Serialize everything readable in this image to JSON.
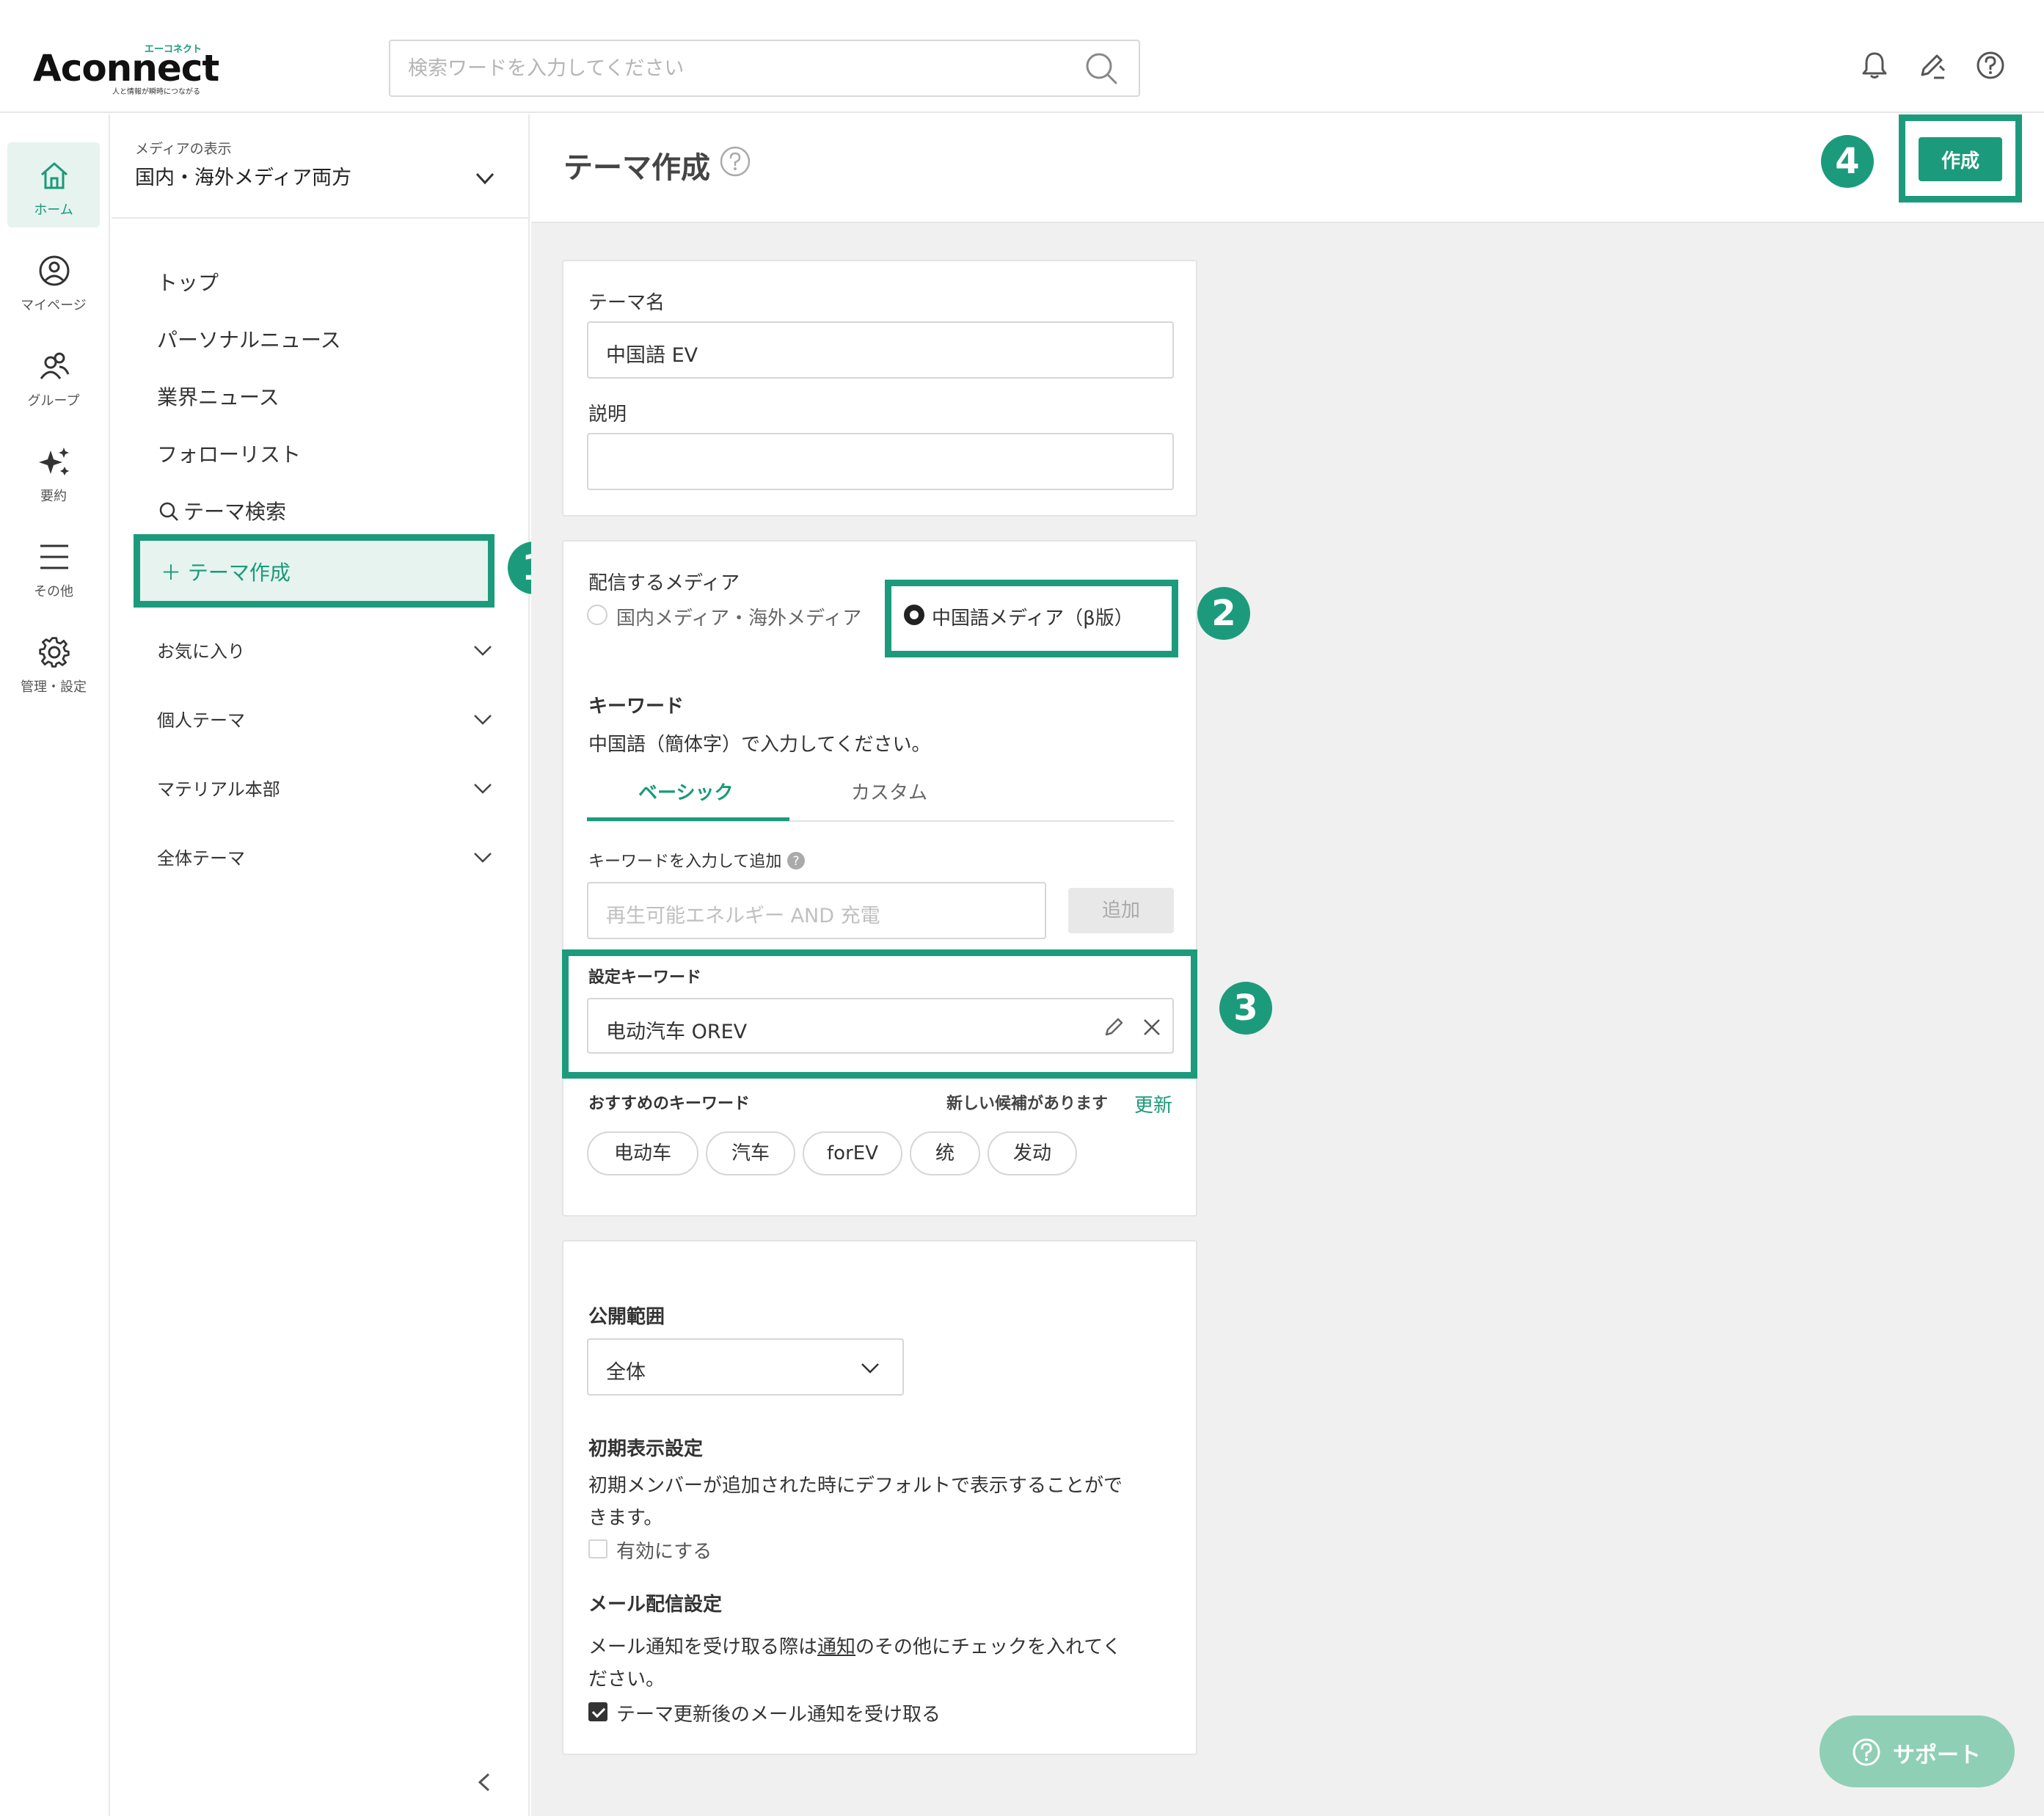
{
  "header": {
    "logo_text": "Aconnect",
    "logo_kana": "エーコネクト",
    "logo_tagline": "人と情報が瞬時につながる",
    "search_placeholder": "検索ワードを入力してください",
    "icons": [
      "bell-icon",
      "edit-icon",
      "help-icon"
    ]
  },
  "rail": {
    "items": [
      {
        "label": "ホーム",
        "icon": "home-icon",
        "active": true
      },
      {
        "label": "マイページ",
        "icon": "user-icon"
      },
      {
        "label": "グループ",
        "icon": "group-icon"
      },
      {
        "label": "要約",
        "icon": "sparkle-icon"
      },
      {
        "label": "その他",
        "icon": "menu-icon"
      },
      {
        "label": "管理・設定",
        "icon": "gear-icon"
      }
    ]
  },
  "sidebar": {
    "media_caption": "メディアの表示",
    "media_value": "国内・海外メディア両方",
    "nav": [
      "トップ",
      "パーソナルニュース",
      "業界ニュース",
      "フォローリスト",
      "テーマ検索"
    ],
    "create_theme": "＋ テーマ作成",
    "accordions": [
      "お気に入り",
      "個人テーマ",
      "マテリアル本部",
      "全体テーマ"
    ]
  },
  "main": {
    "title": "テーマ作成",
    "create_button": "作成",
    "callouts": [
      "1",
      "2",
      "3",
      "4"
    ],
    "theme_name_label": "テーマ名",
    "theme_name_value": "中国語 EV",
    "description_label": "説明",
    "media_label": "配信するメディア",
    "media_options": [
      "国内メディア・海外メディア",
      "中国語メディア（β版）"
    ],
    "keyword_label": "キーワード",
    "keyword_note": "中国語（簡体字）で入力してください。",
    "tabs": [
      "ベーシック",
      "カスタム"
    ],
    "keyword_input_label": "キーワードを入力して追加",
    "keyword_input_placeholder": "再生可能エネルギー AND 充電",
    "add_button": "追加",
    "set_keyword_label": "設定キーワード",
    "set_keyword_value": "电动汽车 OREV",
    "suggest_label": "おすすめのキーワード",
    "suggest_new": "新しい候補があります",
    "suggest_refresh": "更新",
    "chips": [
      "电动车",
      "汽车",
      "forEV",
      "统",
      "发动"
    ],
    "scope_label": "公開範囲",
    "scope_value": "全体",
    "initial_label": "初期表示設定",
    "initial_text_1": "初期メンバーが追加された時にデフォルトで表示することがで",
    "initial_text_2": "きます。",
    "enable_label": "有効にする",
    "mail_label": "メール配信設定",
    "mail_text_1a": "メール通知を受け取る際は",
    "mail_text_1link": "通知",
    "mail_text_1b": "のその他にチェックを入れてく",
    "mail_text_2": "ださい。",
    "mail_checkbox": "テーマ更新後のメール通知を受け取る",
    "support": "サポート"
  },
  "colors": {
    "accent": "#1c9b7c",
    "accent_light": "#e6f3ef",
    "support_bg": "#8fcfb6",
    "main_bg": "#f0f0f0"
  }
}
